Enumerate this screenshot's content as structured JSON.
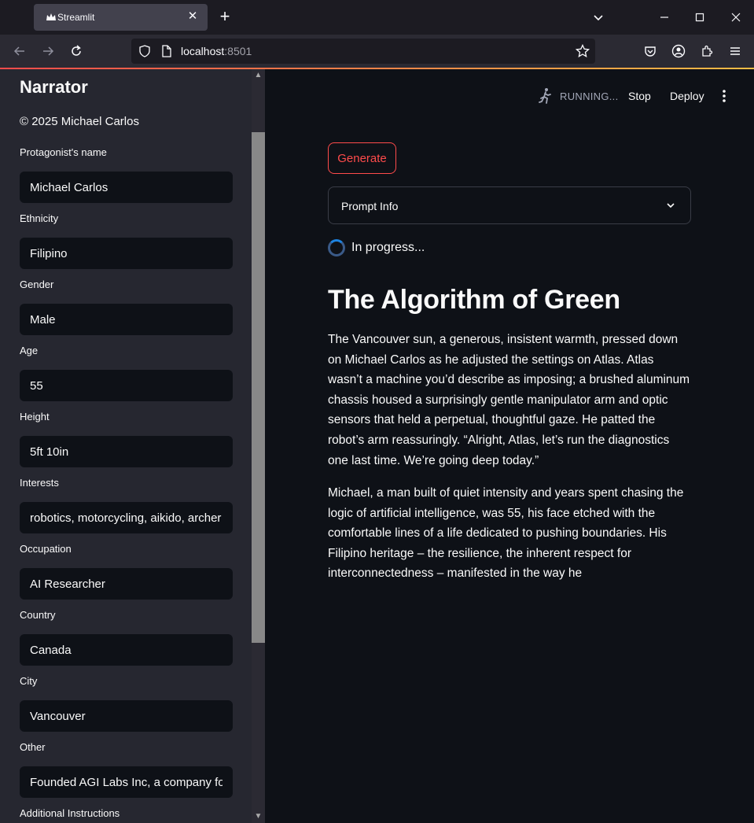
{
  "browser": {
    "tab_title": "Streamlit",
    "tab_close": "✕",
    "new_tab": "+",
    "url_host": "localhost",
    "url_port": ":8501",
    "win_minimize": "—",
    "win_maximize": "☐",
    "win_close": "✕",
    "tab_list": "⌄"
  },
  "sidebar": {
    "title": "Narrator",
    "copyright": "© 2025 Michael Carlos",
    "fields": [
      {
        "label": "Protagonist's name",
        "value": "Michael Carlos"
      },
      {
        "label": "Ethnicity",
        "value": "Filipino"
      },
      {
        "label": "Gender",
        "value": "Male"
      },
      {
        "label": "Age",
        "value": "55"
      },
      {
        "label": "Height",
        "value": "5ft 10in"
      },
      {
        "label": "Interests",
        "value": "robotics, motorcycling, aikido, archer"
      },
      {
        "label": "Occupation",
        "value": "AI Researcher"
      },
      {
        "label": "Country",
        "value": "Canada"
      },
      {
        "label": "City",
        "value": "Vancouver"
      },
      {
        "label": "Other",
        "value": "Founded AGI Labs Inc, a company focu"
      },
      {
        "label": "Additional Instructions",
        "value": ""
      }
    ]
  },
  "header": {
    "status": "RUNNING...",
    "stop": "Stop",
    "deploy": "Deploy"
  },
  "main": {
    "generate": "Generate",
    "expander_label": "Prompt Info",
    "progress_text": "In progress...",
    "story_title": "The Algorithm of Green",
    "paragraphs": [
      "The Vancouver sun, a generous, insistent warmth, pressed down on Michael Carlos as he adjusted the settings on Atlas. Atlas wasn’t a machine you’d describe as imposing; a brushed aluminum chassis housed a surprisingly gentle manipulator arm and optic sensors that held a perpetual, thoughtful gaze. He patted the robot’s arm reassuringly. “Alright, Atlas, let’s run the diagnostics one last time. We’re going deep today.”",
      "Michael, a man built of quiet intensity and years spent chasing the logic of artificial intelligence, was 55, his face etched with the comfortable lines of a life dedicated to pushing boundaries. His Filipino heritage – the resilience, the inherent respect for interconnectedness – manifested in the way he"
    ]
  },
  "colors": {
    "accent": "#ff4b4b",
    "background": "#0e1117",
    "sidebar": "#262730",
    "spinner": "#1c83e1"
  }
}
